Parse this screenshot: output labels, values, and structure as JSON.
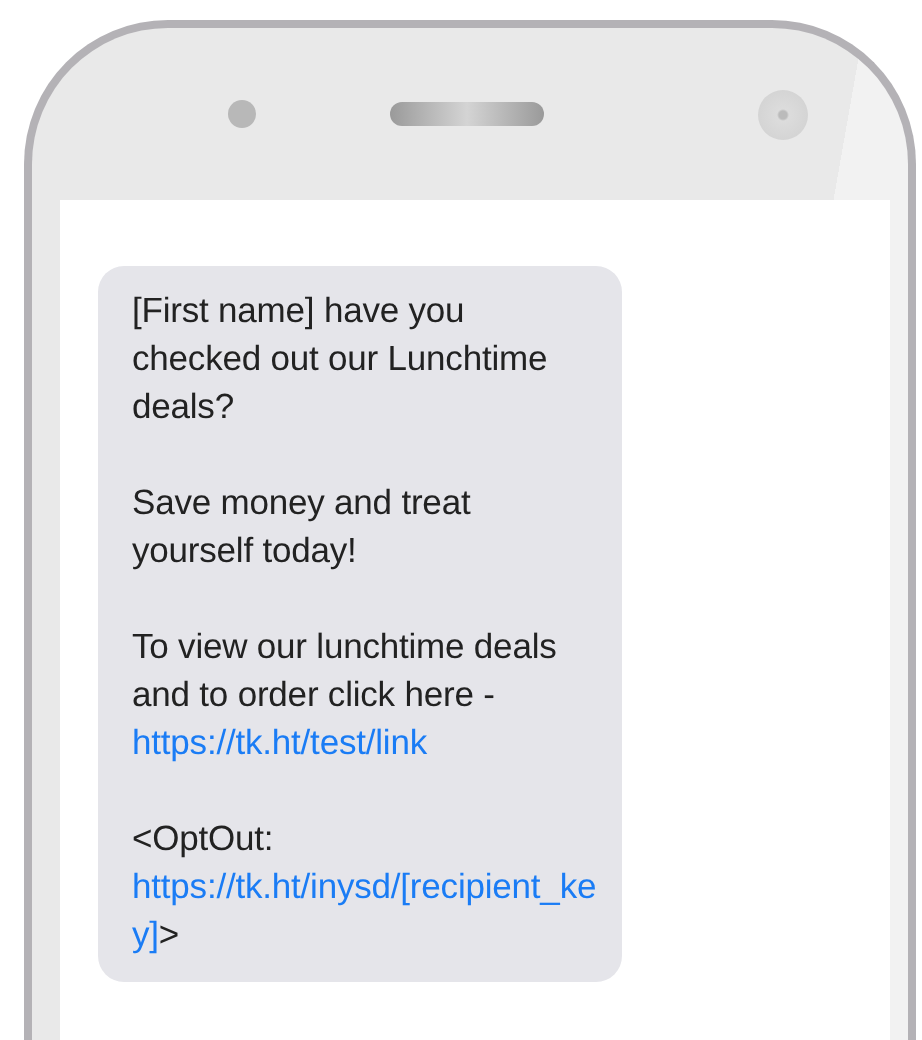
{
  "message": {
    "paragraphs": [
      {
        "text": "[First name] have you checked out our Lunchtime deals?"
      },
      {
        "text": "Save money and treat yourself today!"
      },
      {
        "text": "To view our lunchtime deals and to order click here - ",
        "link": "https://tk.ht/test/link"
      },
      {
        "text": "<OptOut: ",
        "link": "https://tk.ht/inysd/[recipient_key]",
        "suffix": ">"
      }
    ]
  }
}
